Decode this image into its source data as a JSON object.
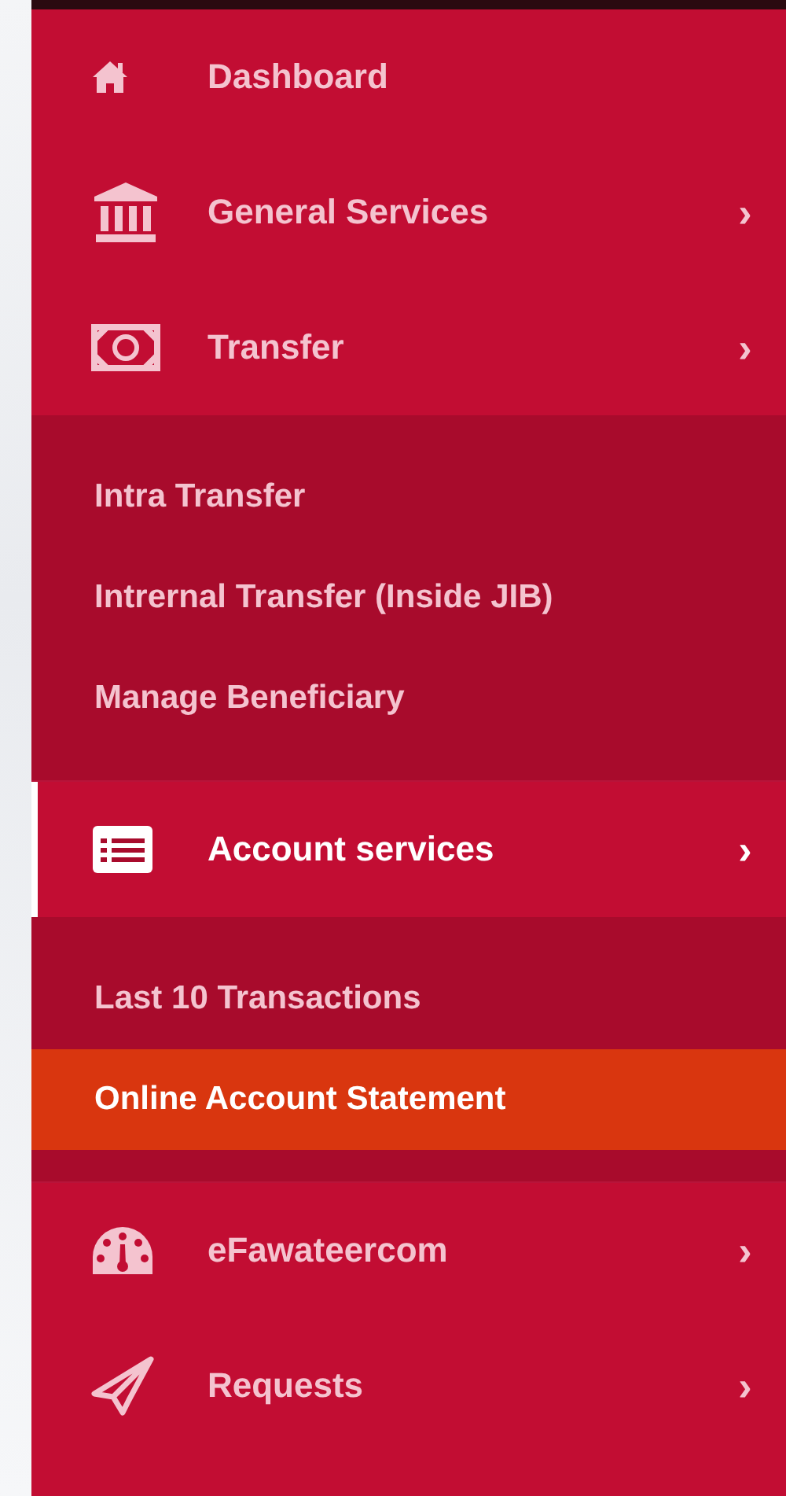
{
  "menu": [
    {
      "label": "Dashboard",
      "has_submenu": false,
      "expanded": false,
      "selected": false
    },
    {
      "label": "General Services",
      "has_submenu": true,
      "expanded": false,
      "selected": false
    },
    {
      "label": "Transfer",
      "has_submenu": true,
      "expanded": true,
      "selected": false,
      "children": [
        {
          "label": "Intra Transfer",
          "selected": false
        },
        {
          "label": "Intrernal Transfer (Inside JIB)",
          "selected": false
        },
        {
          "label": "Manage Beneficiary",
          "selected": false
        }
      ]
    },
    {
      "label": "Account services",
      "has_submenu": true,
      "expanded": true,
      "selected": true,
      "children": [
        {
          "label": "Last 10 Transactions",
          "selected": false
        },
        {
          "label": "Online Account Statement",
          "selected": true
        }
      ]
    },
    {
      "label": "eFawateercom",
      "has_submenu": true,
      "expanded": false,
      "selected": false
    },
    {
      "label": "Requests",
      "has_submenu": true,
      "expanded": false,
      "selected": false
    }
  ],
  "chevron": "›"
}
